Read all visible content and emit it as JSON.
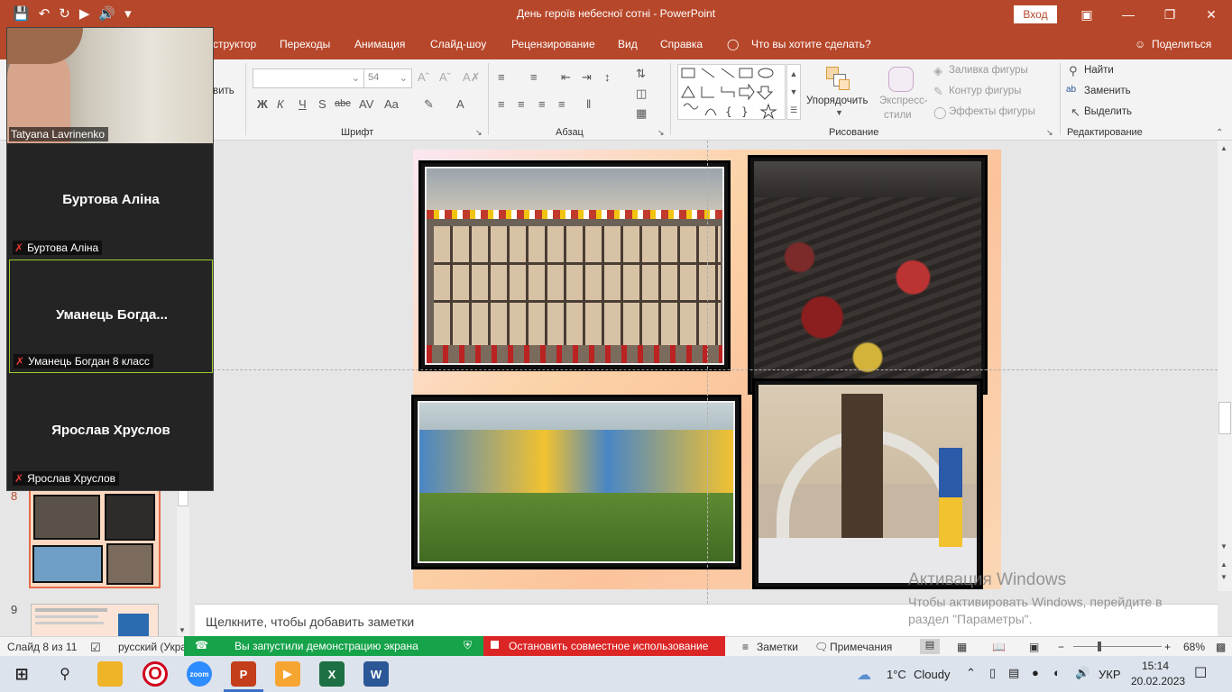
{
  "app": {
    "title": "День героїв небесної сотні  -  PowerPoint",
    "sign_in": "Вход"
  },
  "tabs": [
    "структор",
    "Переходы",
    "Анимация",
    "Слайд-шоу",
    "Рецензирование",
    "Вид",
    "Справка",
    "Что вы хотите сделать?"
  ],
  "share_label": "Поделиться",
  "ribbon": {
    "font_group": "Шрифт",
    "paragraph_group": "Абзац",
    "drawing_group": "Рисование",
    "editing_group": "Редактирование",
    "font_size": "54",
    "paste_fragment": "вить",
    "arrange": "Упорядочить",
    "quick_styles_1": "Экспресс-",
    "quick_styles_2": "стили",
    "shape_fill": "Заливка фигуры",
    "shape_outline": "Контур фигуры",
    "shape_effects": "Эффекты фигуры",
    "find": "Найти",
    "replace": "Заменить",
    "select": "Выделить",
    "font_buttons": [
      "Ж",
      "К",
      "Ч",
      "S",
      "abc",
      "AV",
      "Aa"
    ]
  },
  "thumbnails": {
    "slide_8_number": "8",
    "slide_9_number": "9"
  },
  "notes_placeholder": "Щелкните, чтобы добавить заметки",
  "activation": {
    "title": "Активация Windows",
    "text": "Чтобы активировать Windows, перейдите в раздел \"Параметры\"."
  },
  "statusbar": {
    "slide_info": "Слайд 8 из 11",
    "language": "русский (Укра",
    "sharing_notice": "Вы запустили демонстрацию экрана",
    "stop_sharing": "Остановить совместное использование",
    "notes": "Заметки",
    "comments": "Примечания",
    "zoom": "68%"
  },
  "taskbar": {
    "temperature": "1°C",
    "weather": "Cloudy",
    "lang": "УКР",
    "time": "15:14",
    "date": "20.02.2023"
  },
  "zoom_participants": [
    {
      "display": "Tatyana Lavrinenko",
      "label": "Tatyana Lavrinenko"
    },
    {
      "display": "Буртова Аліна",
      "label": "Буртова Аліна"
    },
    {
      "display": "Уманець  Богда...",
      "label": "Уманець Богдан 8 класс"
    },
    {
      "display": "Ярослав Хруслов",
      "label": "Ярослав Хруслов"
    }
  ]
}
